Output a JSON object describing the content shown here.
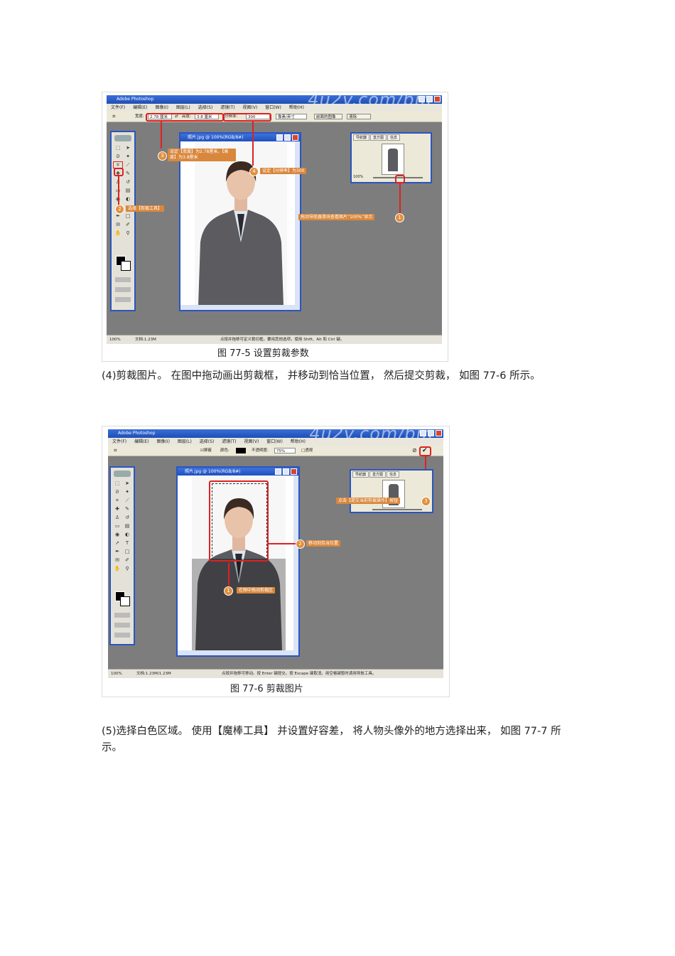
{
  "figure1": {
    "app_title": "Adobe Photoshop",
    "watermark": "4u2v.com/bm",
    "menu": [
      "文件(F)",
      "编辑(E)",
      "图像(I)",
      "图层(L)",
      "选择(S)",
      "滤镜(T)",
      "视图(V)",
      "窗口(W)",
      "帮助(H)"
    ],
    "options": {
      "width_label": "宽度:",
      "width_value": "2.78 厘米",
      "height_label": "高度:",
      "height_value": "3.8 厘米",
      "resolution_label": "分辨率:",
      "resolution_value": "300",
      "unit_value": "像素/英寸",
      "front_image_button": "前面的图像",
      "clear_button": "清除"
    },
    "doc_title": "照片.jpg @ 100%(RGB/8#)",
    "navigator": {
      "tabs": [
        "导航器",
        "直方图",
        "信息"
      ],
      "zoom": "100%"
    },
    "callouts": [
      {
        "num": "3",
        "text": "设定【宽度】为2.78厘米，【高度】为3.8厘米"
      },
      {
        "num": "4",
        "text": "设定【分辨率】为300"
      },
      {
        "num": "2",
        "text": "选择【剪裁工具】"
      },
      {
        "num": "1",
        "text": "拖动导航器滑块查看图片“100%”显示"
      }
    ],
    "status": {
      "zoom": "100%",
      "doc_size": "文档:1.23M",
      "hint": "点按并拖移可定义裁切框。要用其他选项，使用 Shift、Alt 和 Ctrl 键。"
    },
    "caption": "图 77-5   设置剪裁参数"
  },
  "paragraph1": "(4)剪裁图片。 在图中拖动画出剪裁框，   并移动到恰当位置，   然后提交剪裁，   如图  77-6  所示。",
  "figure2": {
    "app_title": "Adobe Photoshop",
    "watermark": "4u2v.com/bm",
    "menu": [
      "文件(F)",
      "编辑(E)",
      "图像(I)",
      "图层(L)",
      "选择(S)",
      "滤镜(T)",
      "视图(V)",
      "窗口(W)",
      "帮助(H)"
    ],
    "options": {
      "shield_label": "☑屏蔽",
      "color_label": "颜色:",
      "opacity_label": "不透明度:",
      "opacity_value": "75%",
      "perspective_label": "□透视"
    },
    "doc_title": "照片.jpg @ 100%(RGB/8#)",
    "navigator": {
      "tabs": [
        "导航器",
        "直方图",
        "信息"
      ]
    },
    "callouts": [
      {
        "num": "3",
        "text": "点击【提交当前剪裁操作】按钮"
      },
      {
        "num": "2",
        "text": "移动到恰当位置"
      },
      {
        "num": "1",
        "text": "在图中拖动剪裁区"
      }
    ],
    "status": {
      "zoom": "100%",
      "doc_size": "文档:1.23M/1.23M",
      "hint": "点按并拖移可移动。按 Enter 键提交。按 Escape 键取消。用空格键暂时调用导航工具。"
    },
    "caption": "图 77-6   剪裁图片"
  },
  "paragraph2": "(5)选择白色区域。 使用【魔棒工具】  并设置好容差，   将人物头像外的地方选择出来，     如图   77-7 所示。"
}
